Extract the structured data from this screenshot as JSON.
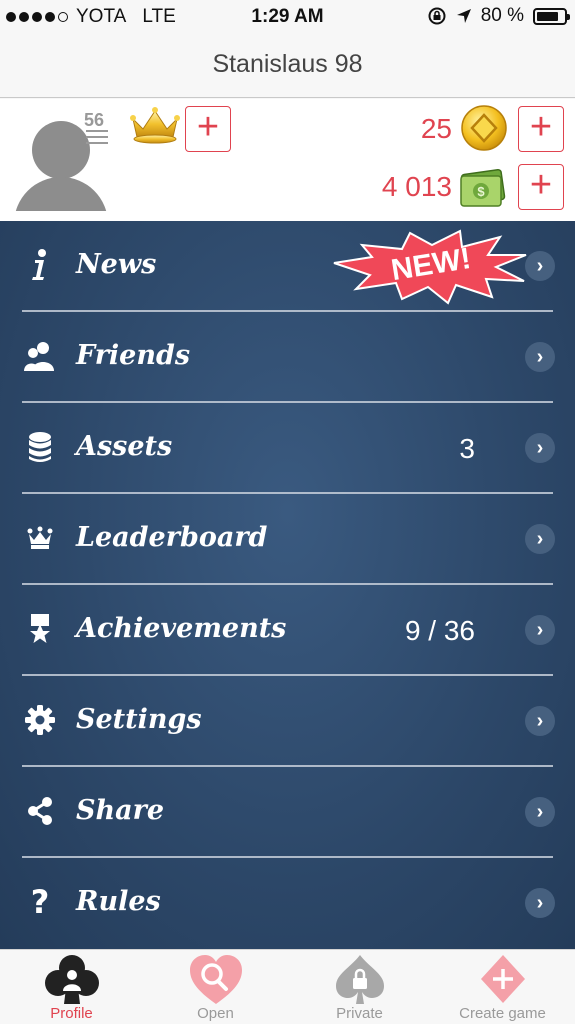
{
  "status_bar": {
    "carrier": "YOTA",
    "network": "LTE",
    "time": "1:29 AM",
    "battery_text": "80 %",
    "battery_level": 0.8,
    "signal_bars": 4,
    "signal_total": 5
  },
  "title": "Stanislaus 98",
  "profile": {
    "level": "56",
    "coins": "25",
    "cash": "4 013"
  },
  "menu": [
    {
      "label": "News",
      "icon": "info-icon",
      "value": "",
      "badge": "NEW!"
    },
    {
      "label": "Friends",
      "icon": "friends-icon",
      "value": ""
    },
    {
      "label": "Assets",
      "icon": "coins-stack-icon",
      "value": "3"
    },
    {
      "label": "Leaderboard",
      "icon": "crown-icon",
      "value": ""
    },
    {
      "label": "Achievements",
      "icon": "medal-icon",
      "value": "9 / 36"
    },
    {
      "label": "Settings",
      "icon": "gear-icon",
      "value": ""
    },
    {
      "label": "Share",
      "icon": "share-icon",
      "value": ""
    },
    {
      "label": "Rules",
      "icon": "question-icon",
      "value": ""
    }
  ],
  "tabs": [
    {
      "label": "Profile",
      "icon": "club-profile-icon",
      "active": true
    },
    {
      "label": "Open",
      "icon": "heart-search-icon",
      "active": false
    },
    {
      "label": "Private",
      "icon": "spade-lock-icon",
      "active": false
    },
    {
      "label": "Create game",
      "icon": "diamond-plus-icon",
      "active": false
    }
  ],
  "colors": {
    "accent": "#e0434f",
    "menu_bg": "#2f4b6e",
    "tab_inactive": "#9a9a9a"
  }
}
